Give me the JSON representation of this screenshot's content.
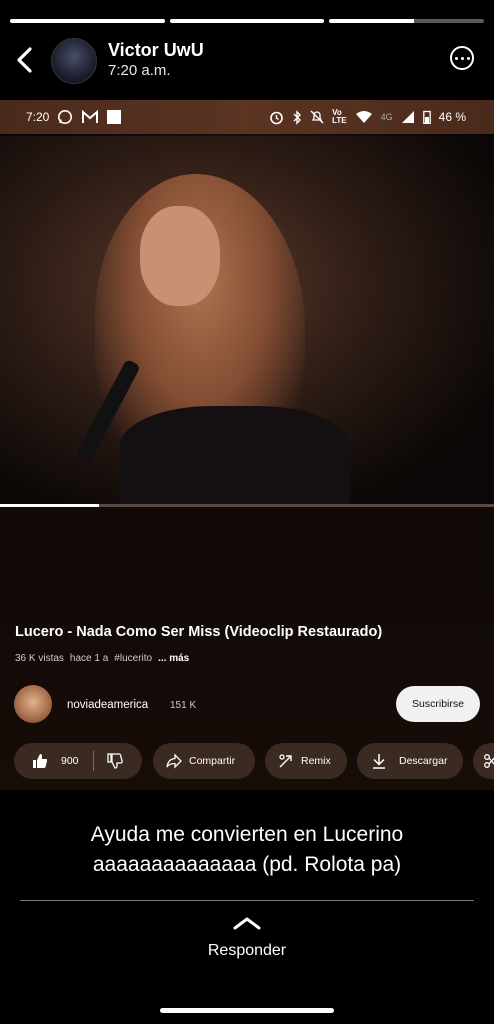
{
  "story": {
    "progress": [
      1,
      1,
      0.55
    ],
    "user_name": "Victor UwU",
    "time": "7:20 a.m.",
    "caption_line1": "Ayuda me convierten en Lucerino",
    "caption_line2": "aaaaaaaaaaaaaa (pd. Rolota pa)",
    "reply_label": "Responder"
  },
  "phone_status": {
    "time": "7:20",
    "network": "4G",
    "lte": "LTE",
    "battery": "46 %"
  },
  "video": {
    "progress": 0.2,
    "title": "Lucero - Nada Como Ser Miss (Videoclip Restaurado)",
    "views": "36 K vistas",
    "age": "hace 1 a",
    "hashtag": "#lucerito",
    "more": "... más",
    "channel_name": "noviadeamerica",
    "subscribers": "151 K",
    "subscribe_label": "Suscribirse",
    "likes": "900",
    "share_label": "Compartir",
    "remix_label": "Remix",
    "download_label": "Descargar"
  }
}
